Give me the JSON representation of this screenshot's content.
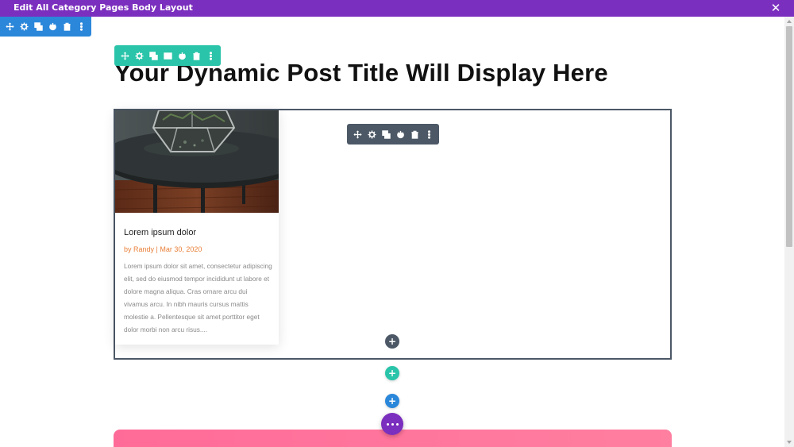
{
  "window": {
    "title": "Edit All Category Pages Body Layout",
    "close_label": "✕"
  },
  "toolbars": {
    "section": [
      "move",
      "settings",
      "duplicate",
      "toggle",
      "delete",
      "more"
    ],
    "row": [
      "move",
      "settings",
      "duplicate",
      "columns",
      "toggle",
      "delete",
      "more"
    ],
    "module": [
      "move",
      "settings",
      "duplicate",
      "toggle",
      "delete",
      "more"
    ]
  },
  "page": {
    "title": "Your Dynamic Post Title Will Display Here"
  },
  "post_card": {
    "title": "Lorem ipsum dolor",
    "meta": "by Randy | Mar 30, 2020",
    "excerpt": "Lorem ipsum dolor sit amet, consectetur adipiscing elit, sed do eiusmod tempor incididunt ut labore et dolore magna aliqua. Cras ornare arcu dui vivamus arcu. In nibh mauris cursus mattis molestie a. Pellentesque sit amet porttitor eget dolor morbi non arcu risus...."
  },
  "buttons": {
    "add_module": "+",
    "add_row": "+",
    "add_section": "+"
  },
  "colors": {
    "builder_purple": "#7b2fbe",
    "section_blue": "#2b87da",
    "row_teal": "#29c4a9",
    "module_gray": "#4c5866",
    "meta_orange": "#e9803a",
    "section_pink": "#ff6b98"
  }
}
